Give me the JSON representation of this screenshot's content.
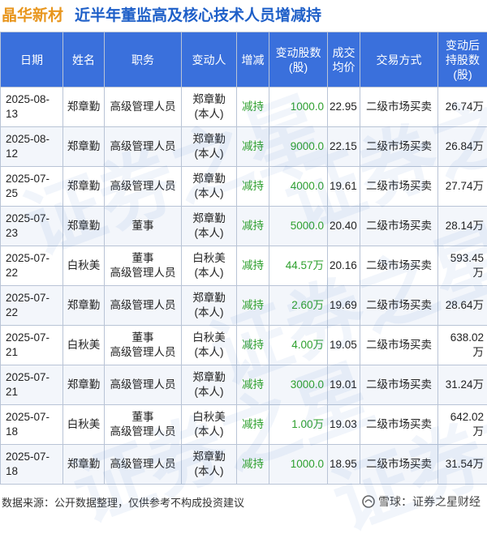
{
  "title": {
    "company": "晶华新材",
    "subtitle": "近半年董监高及核心技术人员增减持"
  },
  "table": {
    "headers": [
      [
        "日期"
      ],
      [
        "姓名"
      ],
      [
        "职务"
      ],
      [
        "变动人"
      ],
      [
        "增减"
      ],
      [
        "变动股数",
        "(股)"
      ],
      [
        "成交",
        "均价"
      ],
      [
        "交易方式"
      ],
      [
        "变动后",
        "持股数",
        "(股)"
      ]
    ],
    "rows": [
      {
        "date": "2025-08-13",
        "name": "郑章勤",
        "role": [
          "高级管理人员"
        ],
        "person": [
          "郑章勤",
          "(本人)"
        ],
        "dir": "减持",
        "shares": "1000.0",
        "price": "22.95",
        "method": "二级市场买卖",
        "after": "26.74万"
      },
      {
        "date": "2025-08-12",
        "name": "郑章勤",
        "role": [
          "高级管理人员"
        ],
        "person": [
          "郑章勤",
          "(本人)"
        ],
        "dir": "减持",
        "shares": "9000.0",
        "price": "22.15",
        "method": "二级市场买卖",
        "after": "26.84万"
      },
      {
        "date": "2025-07-25",
        "name": "郑章勤",
        "role": [
          "高级管理人员"
        ],
        "person": [
          "郑章勤",
          "(本人)"
        ],
        "dir": "减持",
        "shares": "4000.0",
        "price": "19.61",
        "method": "二级市场买卖",
        "after": "27.74万"
      },
      {
        "date": "2025-07-23",
        "name": "郑章勤",
        "role": [
          "董事"
        ],
        "person": [
          "郑章勤",
          "(本人)"
        ],
        "dir": "减持",
        "shares": "5000.0",
        "price": "20.40",
        "method": "二级市场买卖",
        "after": "28.14万"
      },
      {
        "date": "2025-07-22",
        "name": "白秋美",
        "role": [
          "董事",
          "高级管理人员"
        ],
        "person": [
          "白秋美",
          "(本人)"
        ],
        "dir": "减持",
        "shares": "44.57万",
        "price": "20.16",
        "method": "二级市场买卖",
        "after": "593.45万"
      },
      {
        "date": "2025-07-22",
        "name": "郑章勤",
        "role": [
          "高级管理人员"
        ],
        "person": [
          "郑章勤",
          "(本人)"
        ],
        "dir": "减持",
        "shares": "2.60万",
        "price": "19.69",
        "method": "二级市场买卖",
        "after": "28.64万"
      },
      {
        "date": "2025-07-21",
        "name": "白秋美",
        "role": [
          "董事",
          "高级管理人员"
        ],
        "person": [
          "白秋美",
          "(本人)"
        ],
        "dir": "减持",
        "shares": "4.00万",
        "price": "19.05",
        "method": "二级市场买卖",
        "after": "638.02万"
      },
      {
        "date": "2025-07-21",
        "name": "郑章勤",
        "role": [
          "高级管理人员"
        ],
        "person": [
          "郑章勤",
          "(本人)"
        ],
        "dir": "减持",
        "shares": "3000.0",
        "price": "19.01",
        "method": "二级市场买卖",
        "after": "31.24万"
      },
      {
        "date": "2025-07-18",
        "name": "白秋美",
        "role": [
          "董事",
          "高级管理人员"
        ],
        "person": [
          "白秋美",
          "(本人)"
        ],
        "dir": "减持",
        "shares": "1.00万",
        "price": "19.03",
        "method": "二级市场买卖",
        "after": "642.02万"
      },
      {
        "date": "2025-07-18",
        "name": "郑章勤",
        "role": [
          "高级管理人员"
        ],
        "person": [
          "郑章勤",
          "(本人)"
        ],
        "dir": "减持",
        "shares": "1000.0",
        "price": "18.95",
        "method": "二级市场买卖",
        "after": "31.54万"
      }
    ]
  },
  "footer": {
    "source": "数据来源：公开数据整理，仅供参考不构成投资建议",
    "brand": "雪球：证券之星财经"
  },
  "watermark": "证券之星",
  "colors": {
    "header_bg": "#3a70dc",
    "company": "#e8961e",
    "subtitle": "#1e5fc8",
    "decrease": "#2ea02e"
  },
  "icons": {
    "brand": "snowball-icon"
  }
}
